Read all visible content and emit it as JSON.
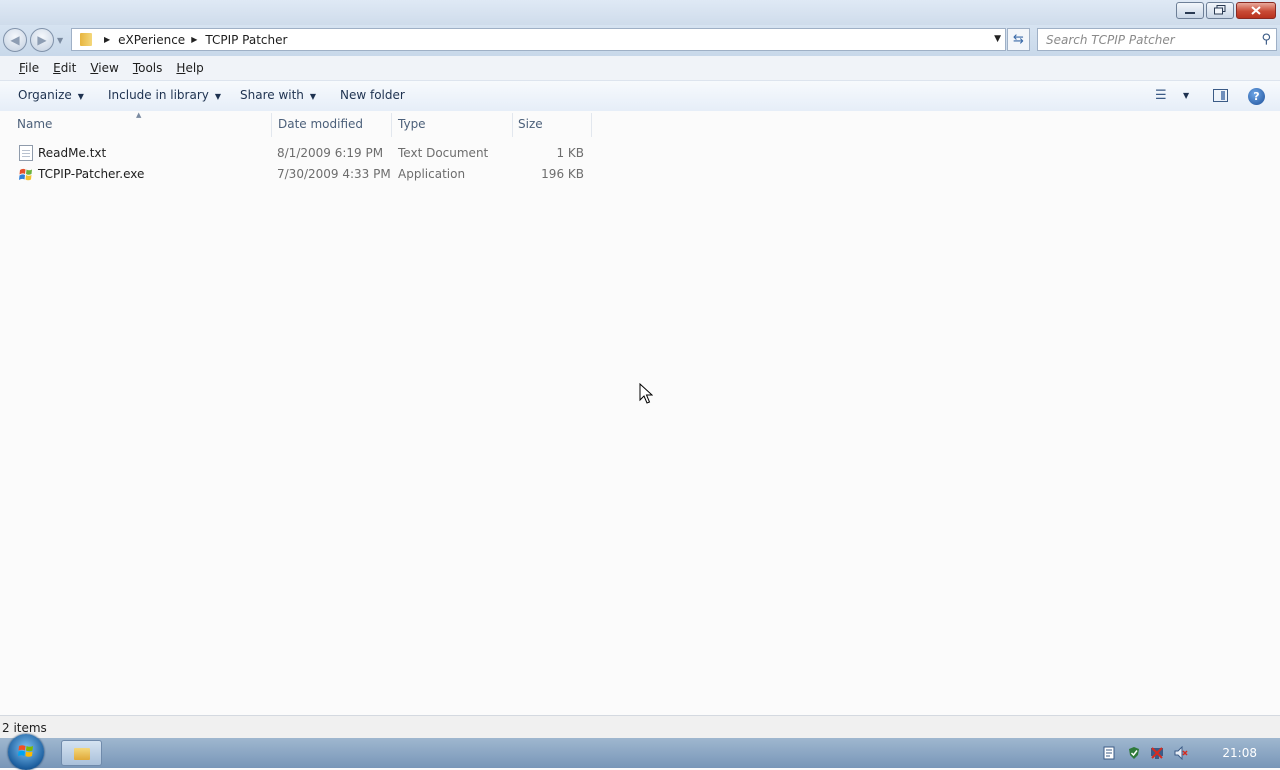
{
  "window": {
    "caption_buttons": [
      "minimize-icon",
      "maximize-icon",
      "close-icon"
    ]
  },
  "address": {
    "breadcrumbs": [
      "eXPerience",
      "TCPIP Patcher"
    ],
    "search_placeholder": "Search TCPIP Patcher"
  },
  "menu": {
    "items": [
      {
        "label": "File",
        "accel": "F",
        "rest": "ile"
      },
      {
        "label": "Edit",
        "accel": "E",
        "rest": "dit"
      },
      {
        "label": "View",
        "accel": "V",
        "rest": "iew"
      },
      {
        "label": "Tools",
        "accel": "T",
        "rest": "ools"
      },
      {
        "label": "Help",
        "accel": "H",
        "rest": "elp"
      }
    ]
  },
  "toolbar": {
    "organize": "Organize",
    "include_in_library": "Include in library",
    "share_with": "Share with",
    "new_folder": "New folder"
  },
  "columns": {
    "name": "Name",
    "date_modified": "Date modified",
    "type": "Type",
    "size": "Size"
  },
  "files": [
    {
      "name": "ReadMe.txt",
      "date": "8/1/2009 6:19 PM",
      "type": "Text Document",
      "size": "1 KB",
      "icon": "text-file-icon"
    },
    {
      "name": "TCPIP-Patcher.exe",
      "date": "7/30/2009 4:33 PM",
      "type": "Application",
      "size": "196 KB",
      "icon": "application-icon"
    }
  ],
  "status": {
    "item_count": "2 items"
  },
  "taskbar": {
    "clock": "21:08",
    "tray_icons": [
      "action-center-icon",
      "security-shield-icon",
      "network-icon",
      "volume-muted-icon"
    ]
  }
}
